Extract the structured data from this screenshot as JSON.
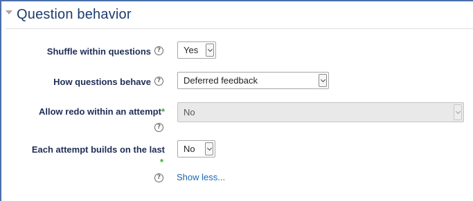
{
  "section": {
    "title": "Question behavior"
  },
  "fields": {
    "shuffle": {
      "label": "Shuffle within questions",
      "value": "Yes"
    },
    "behaviour": {
      "label": "How questions behave",
      "value": "Deferred feedback"
    },
    "redo": {
      "label": "Allow redo within an attempt",
      "required_mark": "*",
      "value": "No"
    },
    "builds": {
      "label": "Each attempt builds on the last",
      "required_mark": "*",
      "value": "No"
    }
  },
  "help_glyph": "?",
  "show_less_link": "Show less...",
  "colors": {
    "title": "#1c3b6d",
    "label": "#1f2d56",
    "required": "#3da83d",
    "link": "#1a66b3",
    "border": "#4a6fa8"
  }
}
